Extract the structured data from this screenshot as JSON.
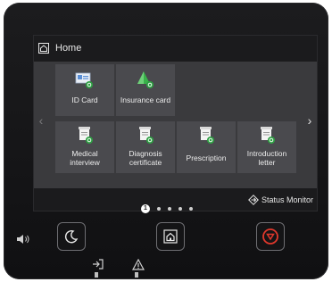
{
  "header": {
    "title": "Home",
    "icon": "home-icon"
  },
  "tiles": [
    {
      "label": "ID Card",
      "icon": "id-card-icon"
    },
    {
      "label": "Insurance card",
      "icon": "insurance-card-icon"
    },
    {
      "label": "Medical interview",
      "line1": "Medical",
      "line2": "interview",
      "icon": "document-icon"
    },
    {
      "label": "Diagnosis certificate",
      "line1": "Diagnosis",
      "line2": "certificate",
      "icon": "document-icon"
    },
    {
      "label": "Prescription",
      "icon": "document-icon"
    },
    {
      "label": "Introduction letter",
      "line1": "Introduction",
      "line2": "letter",
      "icon": "document-icon"
    }
  ],
  "pagination": {
    "current": "1",
    "total_pages": 5
  },
  "status_monitor": {
    "label": "Status Monitor",
    "icon": "status-monitor-icon"
  },
  "hardware": {
    "buttons": [
      "volume-icon",
      "energy-saver-icon",
      "home-button-icon",
      "stop-icon"
    ],
    "indicators": [
      "data-indicator-icon",
      "error-indicator-icon"
    ]
  },
  "colors": {
    "accent_green": "#2ea043",
    "stop_red": "#e0382c"
  }
}
